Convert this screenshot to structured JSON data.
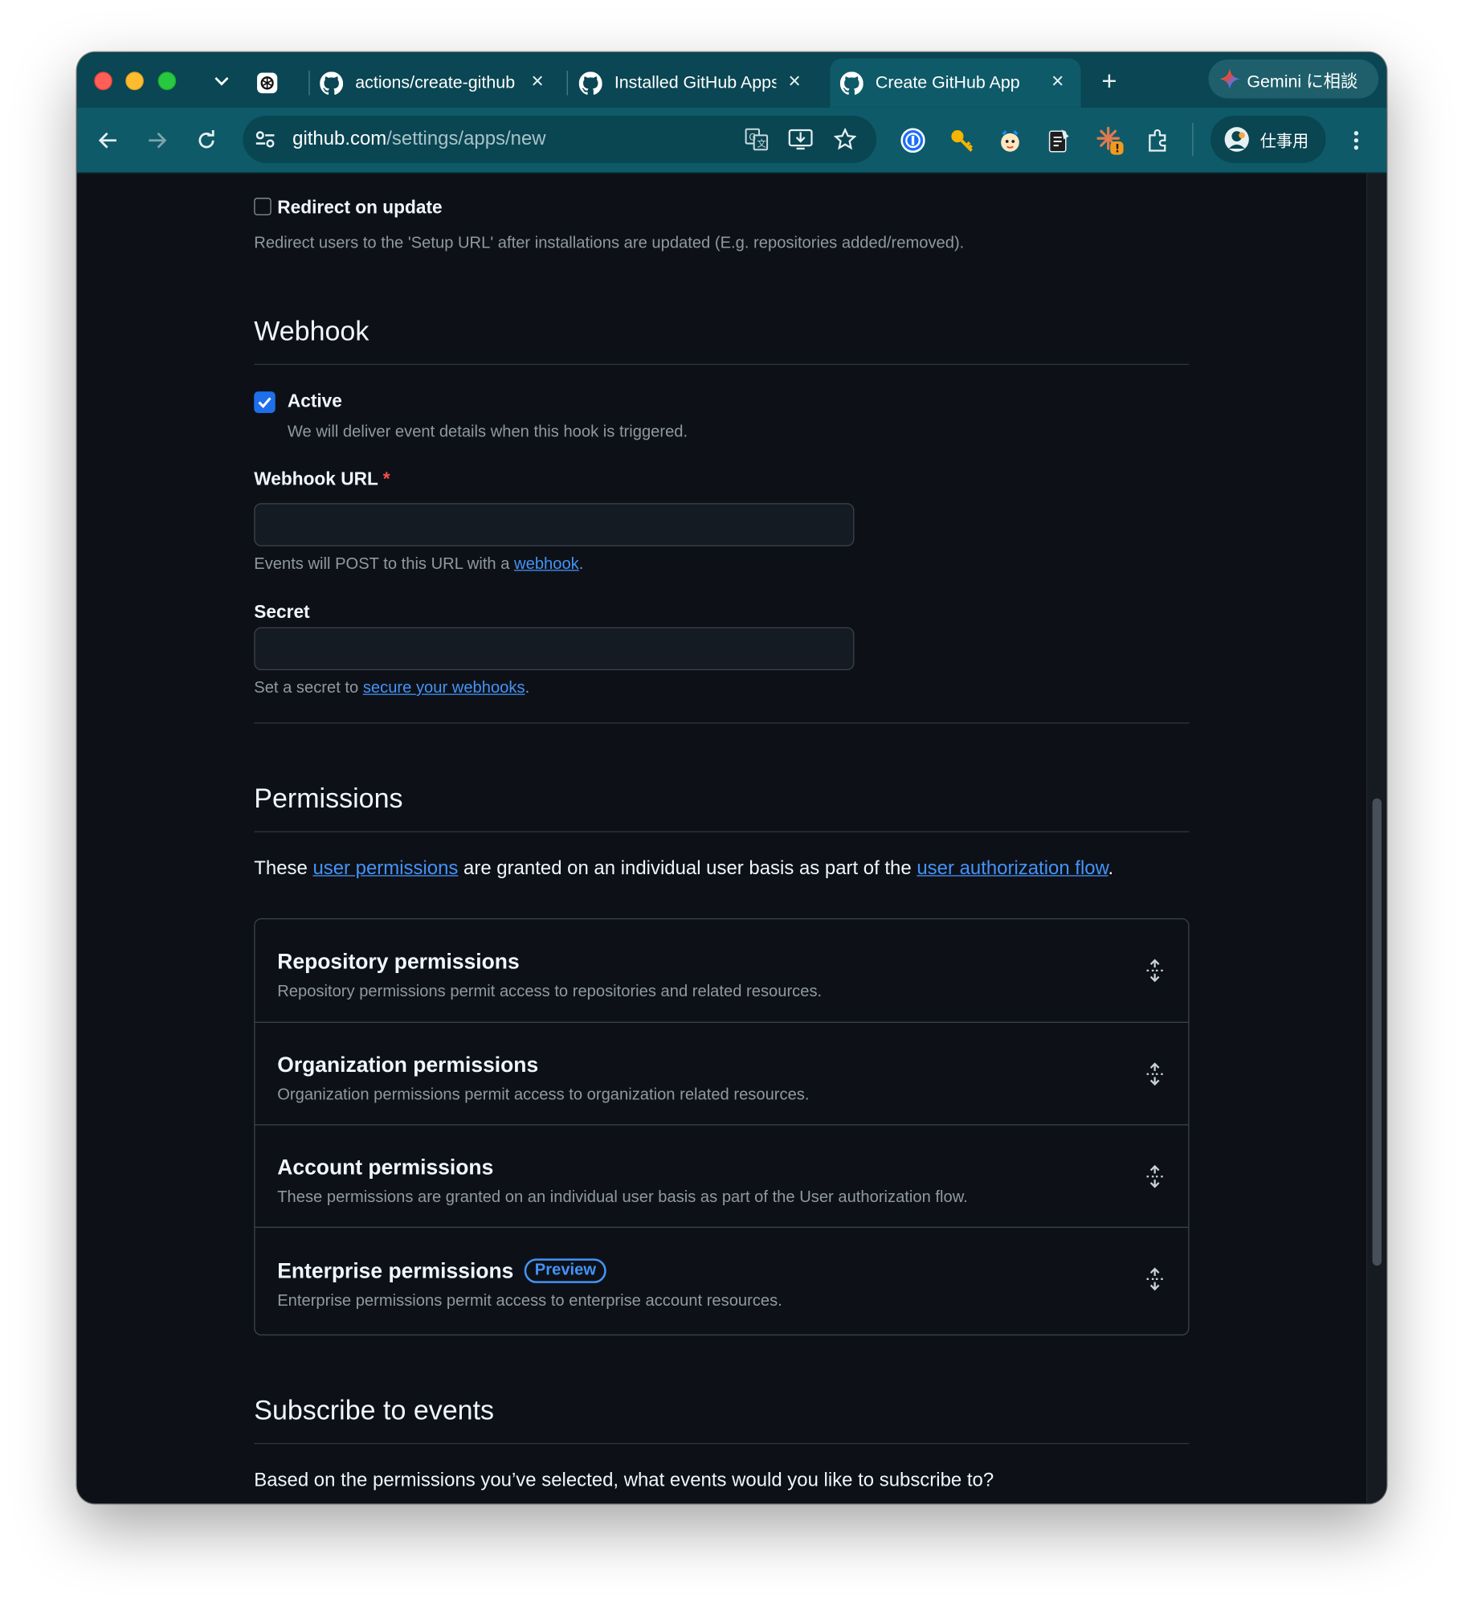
{
  "browser": {
    "tabs": [
      {
        "label": "",
        "icon": "openai-icon"
      },
      {
        "label": "actions/create-githu­b",
        "icon": "github-icon"
      },
      {
        "label": "Installed GitHub Apps",
        "icon": "github-icon"
      },
      {
        "label": "Create GitHub App",
        "icon": "github-icon"
      }
    ],
    "new_tab": "+",
    "gemini_label": "Gemini に相談",
    "url_host": "github.com",
    "url_path": "/settings/apps/new",
    "profile_label": "仕事用",
    "extension_badge": "!"
  },
  "redirect": {
    "label": "Redirect on update",
    "checked": false,
    "description": "Redirect users to the 'Setup URL' after installations are updated (E.g. repositories added/removed)."
  },
  "webhook": {
    "heading": "Webhook",
    "active_label": "Active",
    "active_checked": true,
    "active_description": "We will deliver event details when this hook is triggered.",
    "url_label": "Webhook URL",
    "required_mark": "*",
    "url_value": "",
    "url_help_prefix": "Events will POST to this URL with a ",
    "url_help_link": "webhook",
    "url_help_suffix": ".",
    "secret_label": "Secret",
    "secret_value": "",
    "secret_help_prefix": "Set a secret to ",
    "secret_help_link": "secure your webhooks",
    "secret_help_suffix": "."
  },
  "permissions": {
    "heading": "Permissions",
    "intro_prefix": "These ",
    "intro_link1": "user permissions",
    "intro_middle": " are granted on an individual user basis as part of the ",
    "intro_link2": "user authorization flow",
    "intro_suffix": ".",
    "groups": [
      {
        "title": "Repository permissions",
        "description": "Repository permissions permit access to repositories and related resources."
      },
      {
        "title": "Organization permissions",
        "description": "Organization permissions permit access to organization related resources."
      },
      {
        "title": "Account permissions",
        "description": "These permissions are granted on an individual user basis as part of the User authorization flow."
      },
      {
        "title": "Enterprise permissions",
        "badge": "Preview",
        "description": "Enterprise permissions permit access to enterprise account resources."
      }
    ]
  },
  "events": {
    "heading": "Subscribe to events",
    "question": "Based on the permissions you’ve selected, what events would you like to subscribe to?"
  },
  "colors": {
    "chrome_tabbar": "#0a4653",
    "chrome_toolbar": "#0e5a68",
    "page_bg": "#0d1117",
    "link": "#4493f8",
    "checkbox_checked": "#1f6feb",
    "required": "#f85149"
  }
}
